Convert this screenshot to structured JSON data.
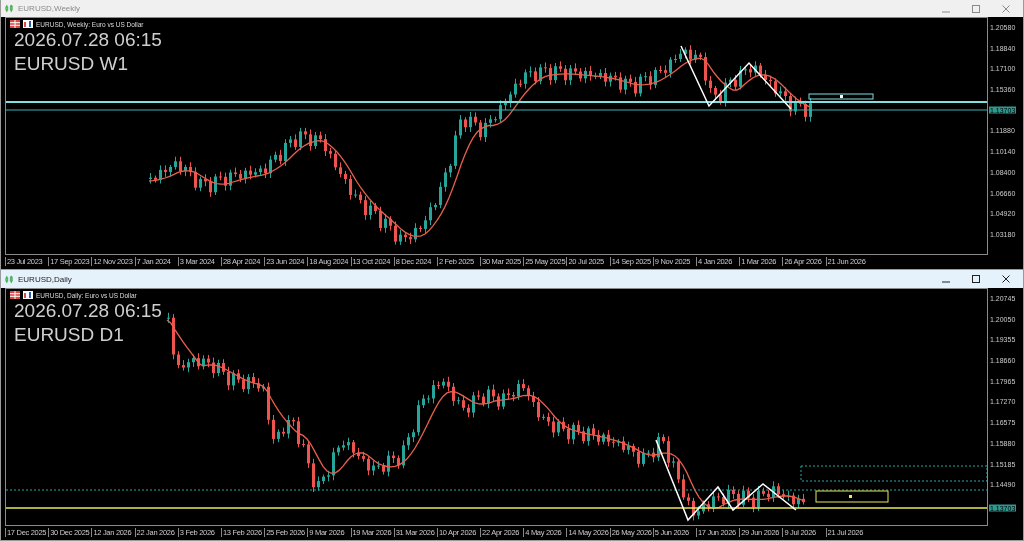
{
  "windows": [
    {
      "title": "EURUSD,Weekly",
      "active": false,
      "chart_header": "EURUSD, Weekly: Euro vs US Dollar",
      "overlay_time": "2026.07.28 06:15",
      "overlay_symbol": "EURUSD W1",
      "current_price": "1.13703",
      "price_axis": [
        "1.20580",
        "1.18840",
        "1.17100",
        "1.15360",
        "1.11880",
        "1.10140",
        "1.08400",
        "1.06660",
        "1.04920",
        "1.03180"
      ],
      "date_axis": [
        "23 Jul 2023",
        "17 Sep 2023",
        "12 Nov 2023",
        "7 Jan 2024",
        "3 Mar 2024",
        "28 Apr 2024",
        "23 Jun 2024",
        "18 Aug 2024",
        "13 Oct 2024",
        "8 Dec 2024",
        "2 Feb 2025",
        "30 Mar 2025",
        "25 May 2025",
        "20 Jul 2025",
        "14 Sep 2025",
        "9 Nov 2025",
        "4 Jan 2026",
        "1 Mar 2026",
        "26 Apr 2026",
        "21 Jun 2026"
      ]
    },
    {
      "title": "EURUSD,Daily",
      "active": true,
      "chart_header": "EURUSD, Daily: Euro vs US Dollar",
      "overlay_time": "2026.07.28 06:15",
      "overlay_symbol": "EURUSD D1",
      "current_price": "1.13703",
      "price_axis": [
        "1.20745",
        "1.20050",
        "1.19355",
        "1.18660",
        "1.17965",
        "1.17270",
        "1.16575",
        "1.15880",
        "1.15185",
        "1.14490"
      ],
      "date_axis": [
        "17 Dec 2025",
        "30 Dec 2025",
        "12 Jan 2026",
        "22 Jan 2026",
        "3 Feb 2026",
        "13 Feb 2026",
        "25 Feb 2026",
        "9 Mar 2026",
        "19 Mar 2026",
        "31 Mar 2026",
        "10 Apr 2026",
        "22 Apr 2026",
        "4 May 2026",
        "14 May 2026",
        "26 May 2026",
        "5 Jun 2026",
        "17 Jun 2026",
        "29 Jun 2026",
        "9 Jul 2026",
        "21 Jul 2026"
      ]
    }
  ]
}
